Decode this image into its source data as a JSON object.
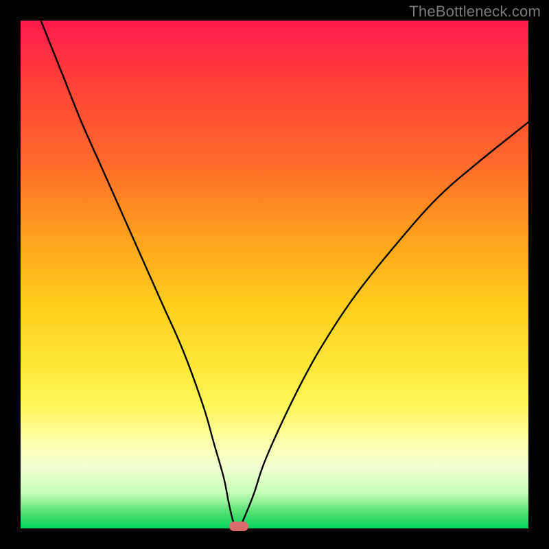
{
  "watermark": "TheBottleneck.com",
  "colors": {
    "frame": "#000000",
    "curve": "#000000",
    "marker": "#d96b6b",
    "watermark": "#7a7a7a"
  },
  "chart_data": {
    "type": "line",
    "title": "",
    "xlabel": "",
    "ylabel": "",
    "xlim": [
      0,
      100
    ],
    "ylim": [
      0,
      100
    ],
    "grid": false,
    "legend": false,
    "series": [
      {
        "name": "bottleneck-curve",
        "x": [
          4,
          8,
          12,
          16,
          20,
          24,
          28,
          32,
          36,
          38,
          40,
          41,
          42,
          43,
          44,
          46,
          48,
          52,
          56,
          60,
          66,
          74,
          82,
          90,
          100
        ],
        "y": [
          100,
          90,
          80,
          71,
          62,
          53,
          44,
          35,
          24,
          17,
          10,
          5,
          1,
          0,
          2,
          7,
          13,
          22,
          30,
          37,
          46,
          56,
          65,
          72,
          80
        ]
      }
    ],
    "marker": {
      "x": 43,
      "y": 0
    },
    "description": "V-shaped curve on a red-to-green vertical gradient; minimum (optimal/no bottleneck) near x≈43%. Values estimated from pixels; no axis ticks or labels are rendered."
  }
}
